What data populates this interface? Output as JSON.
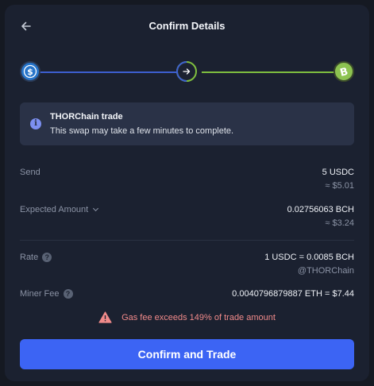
{
  "header": {
    "title": "Confirm Details",
    "back_icon": "arrow-left-icon"
  },
  "route": {
    "from_icon": "usdc-icon",
    "via_icon": "arrow-right-icon",
    "to_icon": "bitcoin-cash-icon",
    "colors": {
      "from": "#2775ca",
      "to": "#8dc351",
      "line_from": "#3d5fd0",
      "line_to": "#7fbf3f"
    }
  },
  "notice": {
    "icon": "info-icon",
    "title": "THORChain trade",
    "text": "This swap may take a few minutes to complete."
  },
  "details": {
    "send": {
      "label": "Send",
      "value": "5 USDC",
      "sub": "≈ $5.01"
    },
    "expected": {
      "label": "Expected Amount",
      "value": "0.02756063 BCH",
      "sub": "≈ $3.24"
    },
    "rate": {
      "label": "Rate",
      "value": "1 USDC = 0.0085 BCH",
      "sub": "@THORChain"
    },
    "fee": {
      "label": "Miner Fee",
      "value": "0.0040796879887 ETH = $7.44"
    }
  },
  "warning": {
    "icon": "warning-triangle-icon",
    "text": "Gas fee exceeds 149% of trade amount",
    "color": "#f08a8a"
  },
  "actions": {
    "confirm_label": "Confirm and Trade",
    "accent": "#3c64f4"
  }
}
